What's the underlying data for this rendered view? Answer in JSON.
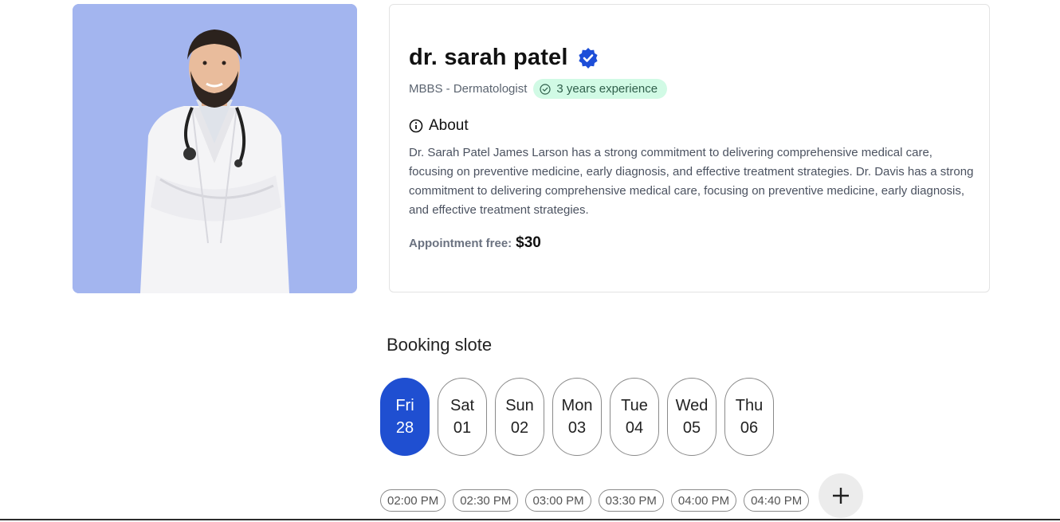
{
  "doctor": {
    "name": "dr. sarah patel",
    "degree": "MBBS - Dermatologist",
    "experience": "3 years experience",
    "about_title": "About",
    "about_text": "Dr. Sarah Patel James Larson has a strong commitment to delivering comprehensive medical care, focusing on preventive medicine, early diagnosis, and effective treatment strategies. Dr. Davis has a strong commitment to delivering comprehensive medical care, focusing on preventive medicine, early diagnosis, and effective treatment strategies.",
    "fee_label": "Appointment free:",
    "fee_value": "$30",
    "photo_background": "#a3b5ef"
  },
  "booking": {
    "title": "Booking slote",
    "days": [
      {
        "day": "Fri",
        "date": "28",
        "selected": true
      },
      {
        "day": "Sat",
        "date": "01",
        "selected": false
      },
      {
        "day": "Sun",
        "date": "02",
        "selected": false
      },
      {
        "day": "Mon",
        "date": "03",
        "selected": false
      },
      {
        "day": "Tue",
        "date": "04",
        "selected": false
      },
      {
        "day": "Wed",
        "date": "05",
        "selected": false
      },
      {
        "day": "Thu",
        "date": "06",
        "selected": false
      }
    ],
    "times": [
      "02:00 PM",
      "02:30 PM",
      "03:00 PM",
      "03:30 PM",
      "04:00 PM",
      "04:40 PM"
    ],
    "add_icon": "plus-icon"
  },
  "colors": {
    "accent": "#1f4fd1",
    "verified": "#1d4ed8",
    "badge_bg": "#d1fae5"
  }
}
